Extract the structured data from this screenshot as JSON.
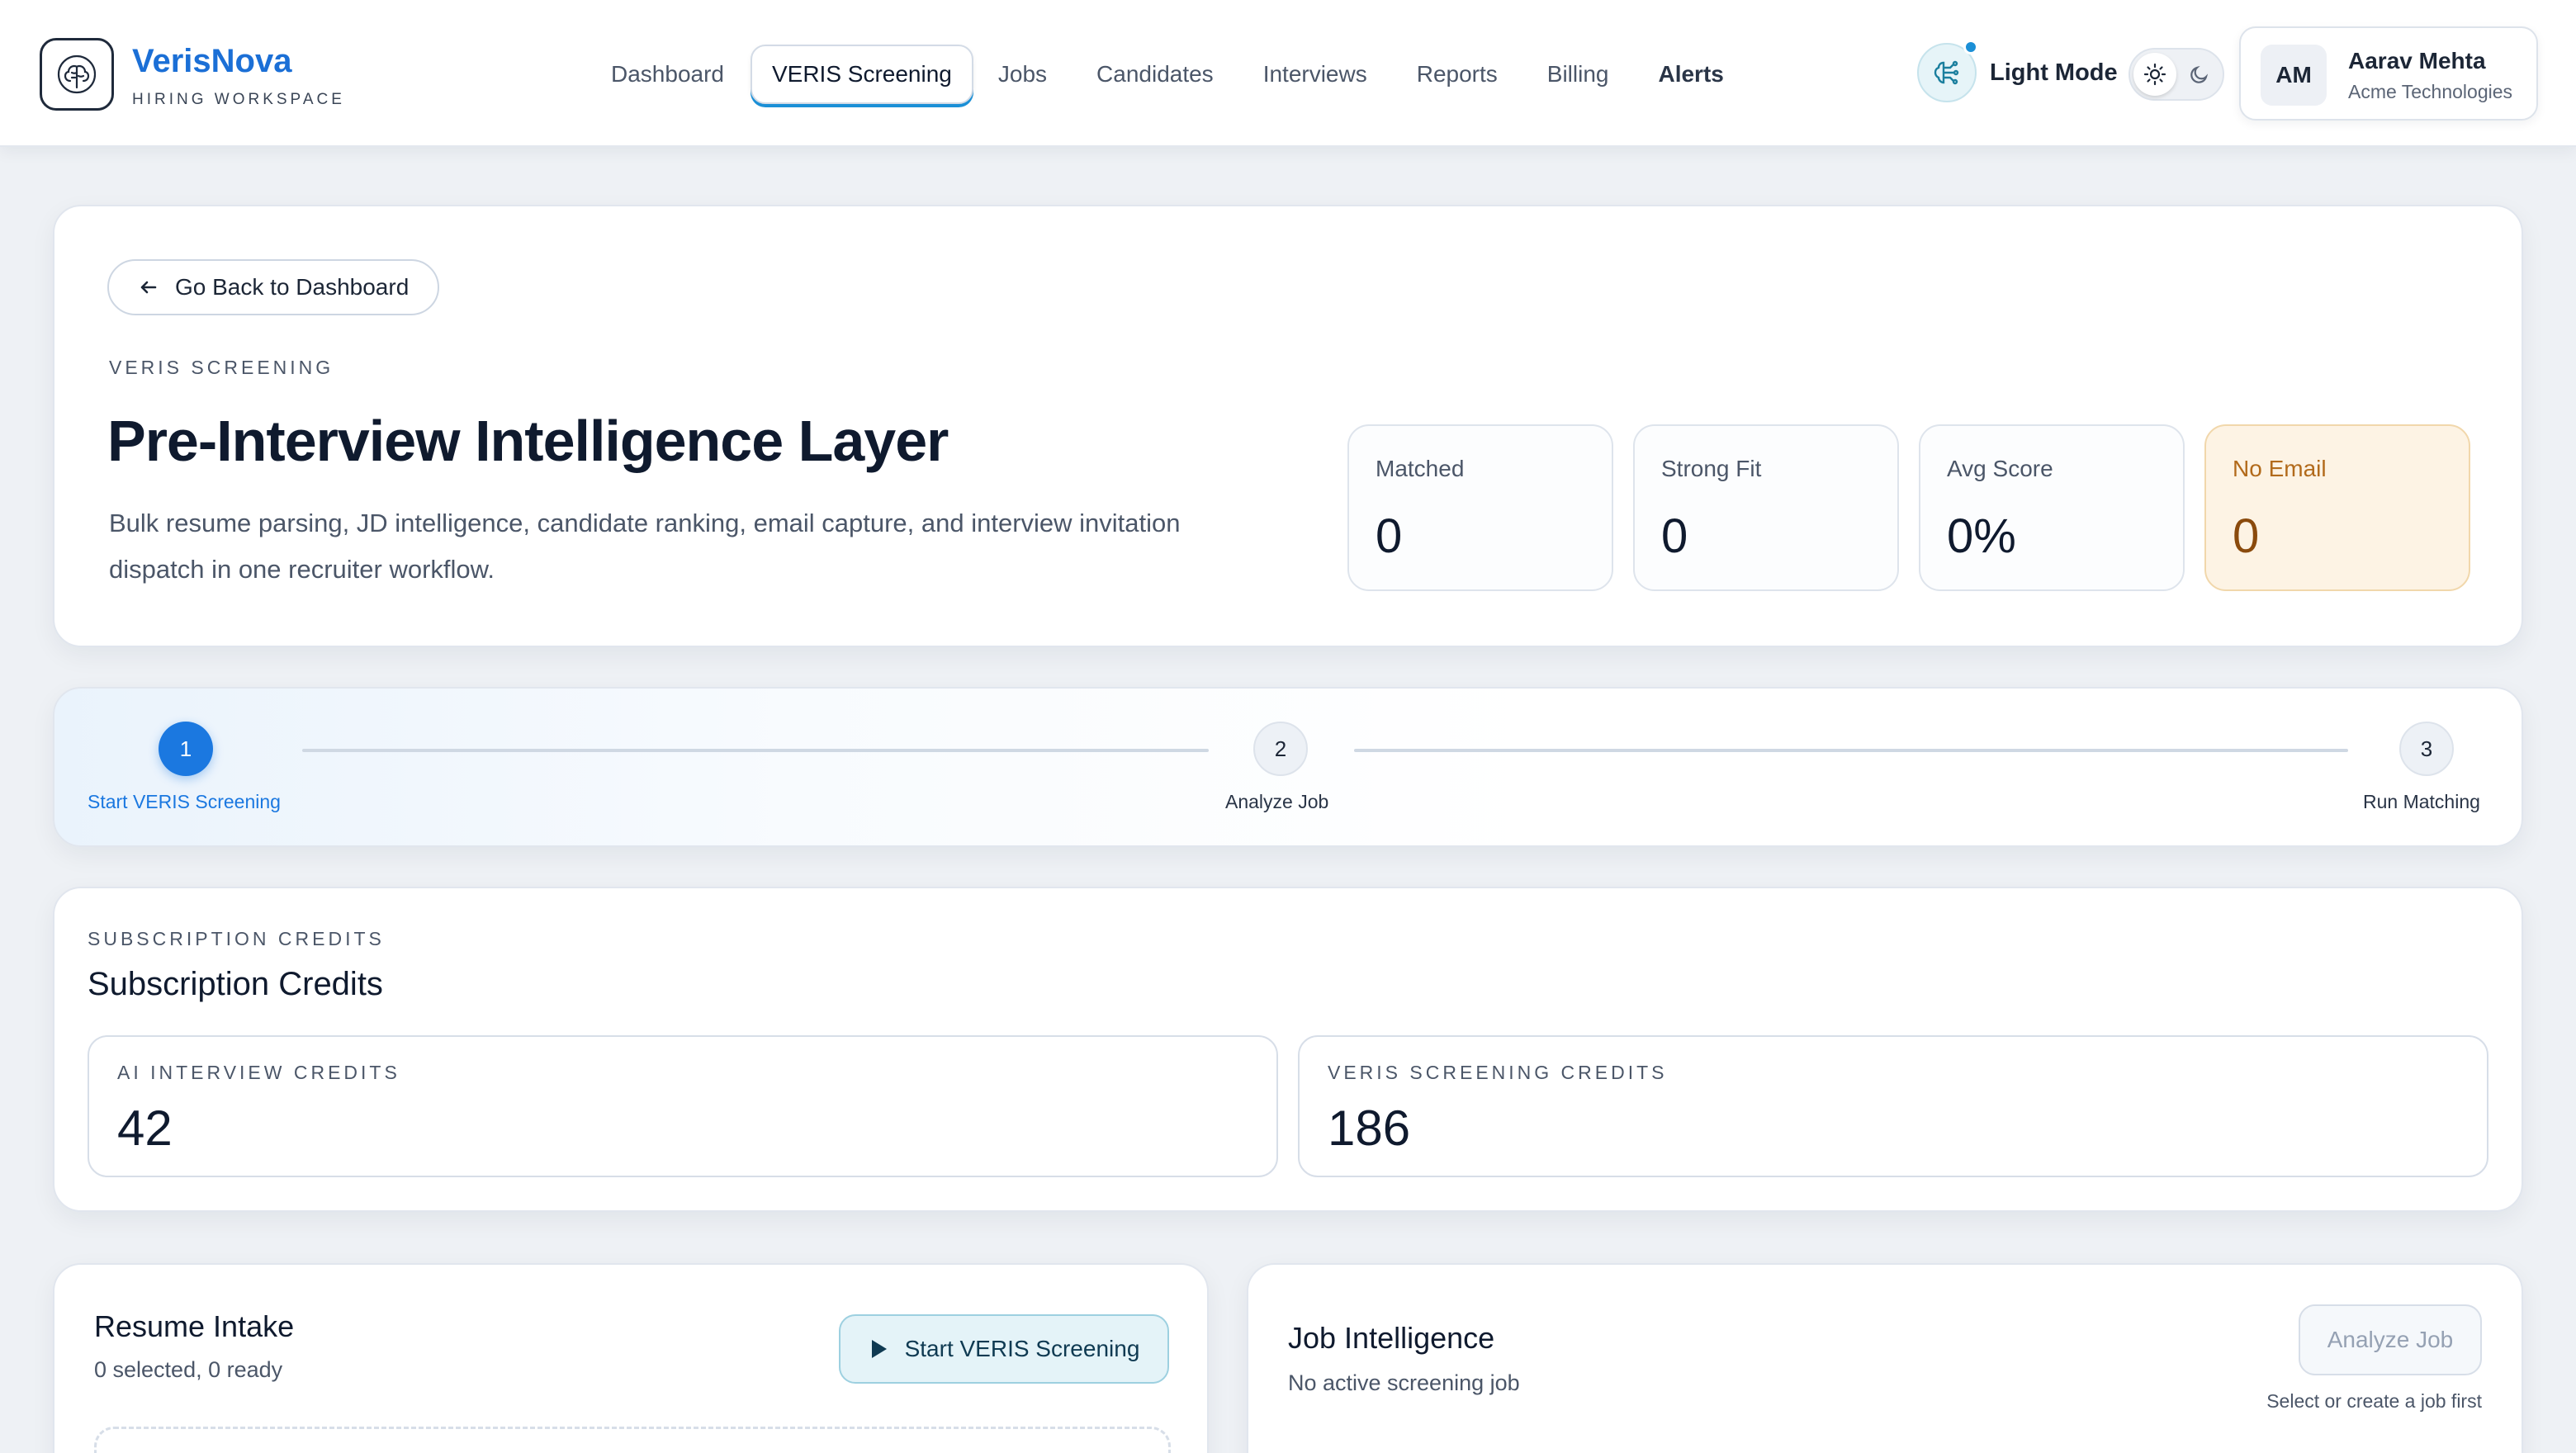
{
  "brand": {
    "name": "VerisNova",
    "subtitle": "HIRING WORKSPACE"
  },
  "nav": {
    "links": [
      {
        "label": "Dashboard"
      },
      {
        "label": "VERIS Screening"
      },
      {
        "label": "Jobs"
      },
      {
        "label": "Candidates"
      },
      {
        "label": "Interviews"
      },
      {
        "label": "Reports"
      },
      {
        "label": "Billing"
      },
      {
        "label": "Alerts"
      }
    ],
    "active": "VERIS Screening"
  },
  "theme": {
    "mode_label": "Light Mode",
    "accent": "#1b78e0",
    "warn_bg": "#fdf3e4"
  },
  "user": {
    "initials": "AM",
    "name": "Aarav Mehta",
    "org": "Acme Technologies"
  },
  "hero": {
    "back_label": "Go Back to Dashboard",
    "eyebrow": "VERIS SCREENING",
    "title": "Pre-Interview Intelligence Layer",
    "description": "Bulk resume parsing, JD intelligence, candidate ranking, email capture, and interview invitation dispatch in one recruiter workflow.",
    "stats": [
      {
        "label": "Matched",
        "value": "0"
      },
      {
        "label": "Strong Fit",
        "value": "0"
      },
      {
        "label": "Avg Score",
        "value": "0%"
      },
      {
        "label": "No Email",
        "value": "0"
      }
    ]
  },
  "stepper": {
    "steps": [
      {
        "number": "1",
        "label": "Start VERIS Screening",
        "state": "active"
      },
      {
        "number": "2",
        "label": "Analyze Job",
        "state": "idle"
      },
      {
        "number": "3",
        "label": "Run Matching",
        "state": "idle"
      }
    ]
  },
  "credits": {
    "eyebrow": "SUBSCRIPTION CREDITS",
    "title": "Subscription Credits",
    "items": [
      {
        "label": "AI INTERVIEW CREDITS",
        "value": "42"
      },
      {
        "label": "VERIS SCREENING CREDITS",
        "value": "186"
      }
    ]
  },
  "resume_intake": {
    "title": "Resume Intake",
    "status": "0 selected, 0 ready",
    "start_label": "Start VERIS Screening"
  },
  "job_intelligence": {
    "title": "Job Intelligence",
    "status": "No active screening job",
    "analyze_label": "Analyze Job",
    "hint": "Select or create a job first"
  }
}
